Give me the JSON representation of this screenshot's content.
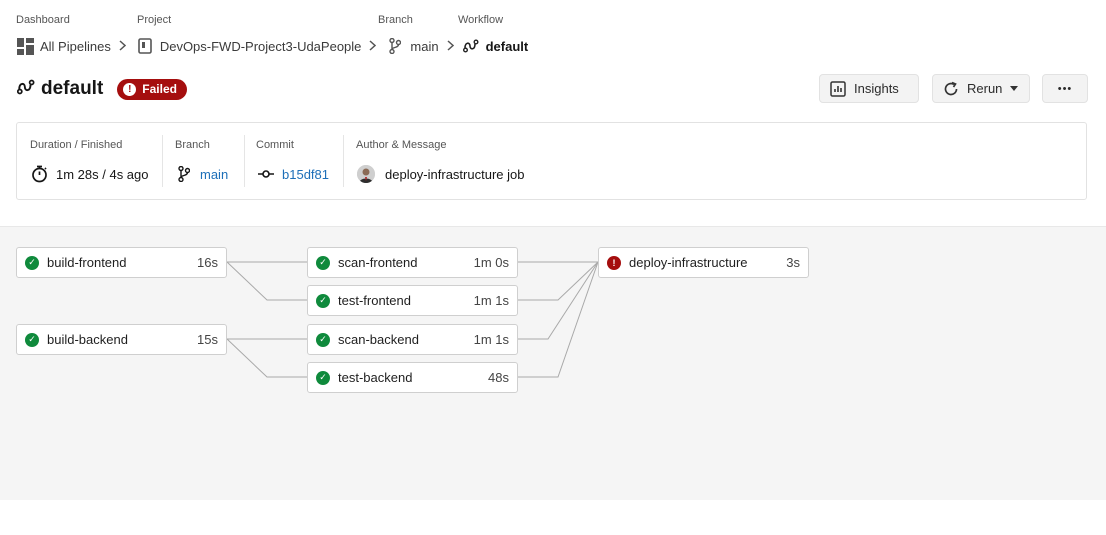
{
  "breadcrumb": {
    "dashboard_label": "Dashboard",
    "dashboard_value": "All Pipelines",
    "project_label": "Project",
    "project_value": "DevOps-FWD-Project3-UdaPeople",
    "branch_label": "Branch",
    "branch_value": "main",
    "workflow_label": "Workflow",
    "workflow_value": "default"
  },
  "header": {
    "title": "default",
    "status": "Failed",
    "status_color": "#a50e0e",
    "insights_label": "Insights",
    "rerun_label": "Rerun",
    "more_label": "•••"
  },
  "info": {
    "duration_label": "Duration / Finished",
    "duration_value": "1m 28s / 4s ago",
    "branch_label": "Branch",
    "branch_value": "main",
    "commit_label": "Commit",
    "commit_value": "b15df81",
    "author_label": "Author & Message",
    "author_message": "deploy-infrastructure job"
  },
  "jobs": [
    {
      "name": "build-frontend",
      "duration": "16s",
      "status": "success"
    },
    {
      "name": "scan-frontend",
      "duration": "1m 0s",
      "status": "success"
    },
    {
      "name": "test-frontend",
      "duration": "1m 1s",
      "status": "success"
    },
    {
      "name": "build-backend",
      "duration": "15s",
      "status": "success"
    },
    {
      "name": "scan-backend",
      "duration": "1m 1s",
      "status": "success"
    },
    {
      "name": "test-backend",
      "duration": "48s",
      "status": "success"
    },
    {
      "name": "deploy-infrastructure",
      "duration": "3s",
      "status": "failed"
    }
  ],
  "colors": {
    "success": "#0f8a3c",
    "failed": "#a50e0e",
    "link": "#1d6fb8"
  }
}
